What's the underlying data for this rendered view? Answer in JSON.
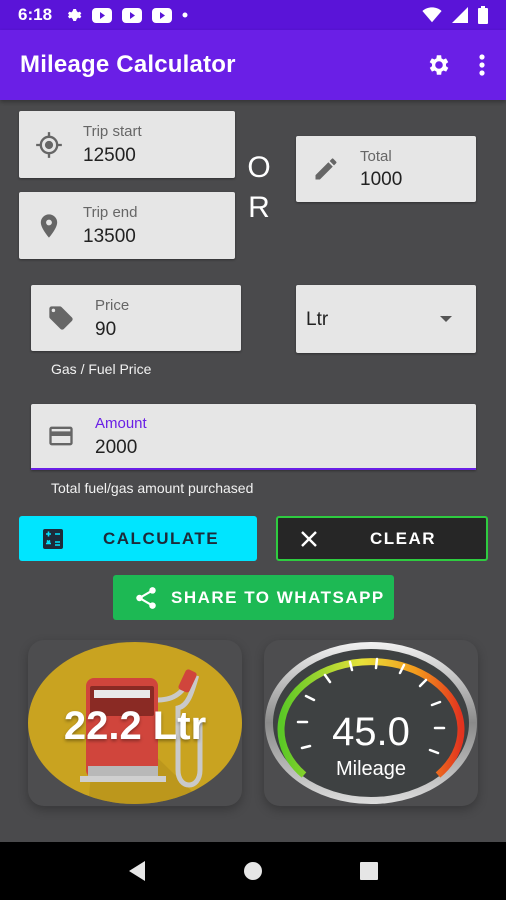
{
  "status_bar": {
    "time": "6:18"
  },
  "app_bar": {
    "title": "Mileage Calculator",
    "settings_icon": "gear-icon",
    "menu_icon": "more-vert-icon"
  },
  "trip_start": {
    "label": "Trip start",
    "value": "12500"
  },
  "trip_end": {
    "label": "Trip end",
    "value": "13500"
  },
  "or_text": [
    "O",
    "R"
  ],
  "total": {
    "label": "Total",
    "value": "1000"
  },
  "price": {
    "label": "Price",
    "value": "90",
    "helper": "Gas / Fuel Price"
  },
  "unit_select": {
    "value": "Ltr"
  },
  "amount": {
    "label": "Amount",
    "value": "2000",
    "helper": "Total fuel/gas amount purchased"
  },
  "buttons": {
    "calculate": "CALCULATE",
    "clear": "CLEAR",
    "share": "SHARE TO WHATSAPP"
  },
  "results": {
    "fuel": "22.2 Ltr",
    "mileage_value": "45.0",
    "mileage_label": "Mileage"
  },
  "colors": {
    "primary": "#6a1fe6",
    "status": "#5a14d8",
    "calculate_bg": "#00e5ff",
    "share_bg": "#1db954",
    "clear_border": "#2ecc40",
    "accent": "#6a1fe6"
  }
}
